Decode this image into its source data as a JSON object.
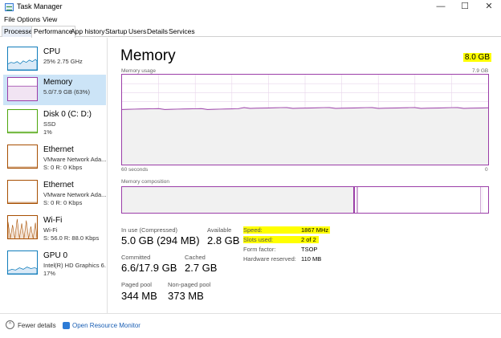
{
  "window": {
    "title": "Task Manager",
    "minimize": "—",
    "maximize": "☐",
    "close": "✕"
  },
  "menu": [
    "File",
    "Options",
    "View"
  ],
  "tabs": [
    "Processes",
    "Performance",
    "App history",
    "Startup",
    "Users",
    "Details",
    "Services"
  ],
  "sidebar": [
    {
      "title": "CPU",
      "sub": "25%  2.75 GHz",
      "sub2": ""
    },
    {
      "title": "Memory",
      "sub": "5.0/7.9 GB (63%)",
      "sub2": ""
    },
    {
      "title": "Disk 0 (C: D:)",
      "sub": "SSD",
      "sub2": "1%"
    },
    {
      "title": "Ethernet",
      "sub": "VMware Network Ada...",
      "sub2": "S: 0  R: 0 Kbps"
    },
    {
      "title": "Ethernet",
      "sub": "VMware Network Ada...",
      "sub2": "S: 0  R: 0 Kbps"
    },
    {
      "title": "Wi-Fi",
      "sub": "Wi-Fi",
      "sub2": "S: 56.0  R: 88.0 Kbps"
    },
    {
      "title": "GPU 0",
      "sub": "Intel(R) HD Graphics 6...",
      "sub2": "17%"
    }
  ],
  "main": {
    "title": "Memory",
    "total": "8.0 GB",
    "usage_label": "Memory usage",
    "usage_max": "7.9 GB",
    "time_left": "60 seconds",
    "time_right": "0",
    "composition_label": "Memory composition",
    "usage_fraction": 0.63
  },
  "stats": {
    "in_use_label": "In use (Compressed)",
    "in_use_value": "5.0 GB (294 MB)",
    "available_label": "Available",
    "available_value": "2.8 GB",
    "committed_label": "Committed",
    "committed_value": "6.6/17.9 GB",
    "cached_label": "Cached",
    "cached_value": "2.7 GB",
    "paged_label": "Paged pool",
    "paged_value": "344 MB",
    "nonpaged_label": "Non-paged pool",
    "nonpaged_value": "373 MB"
  },
  "props": {
    "speed_label": "Speed:",
    "speed_value": "1867 MHz",
    "slots_label": "Slots used:",
    "slots_value": "2 of 2",
    "form_label": "Form factor:",
    "form_value": "TSOP",
    "reserved_label": "Hardware reserved:",
    "reserved_value": "110 MB"
  },
  "footer": {
    "fewer_details": "Fewer details",
    "resource_monitor": "Open Resource Monitor"
  },
  "colors": {
    "memory_accent": "#9b3ea8",
    "highlight": "#ffff00",
    "selected_bg": "#cce4f7"
  }
}
